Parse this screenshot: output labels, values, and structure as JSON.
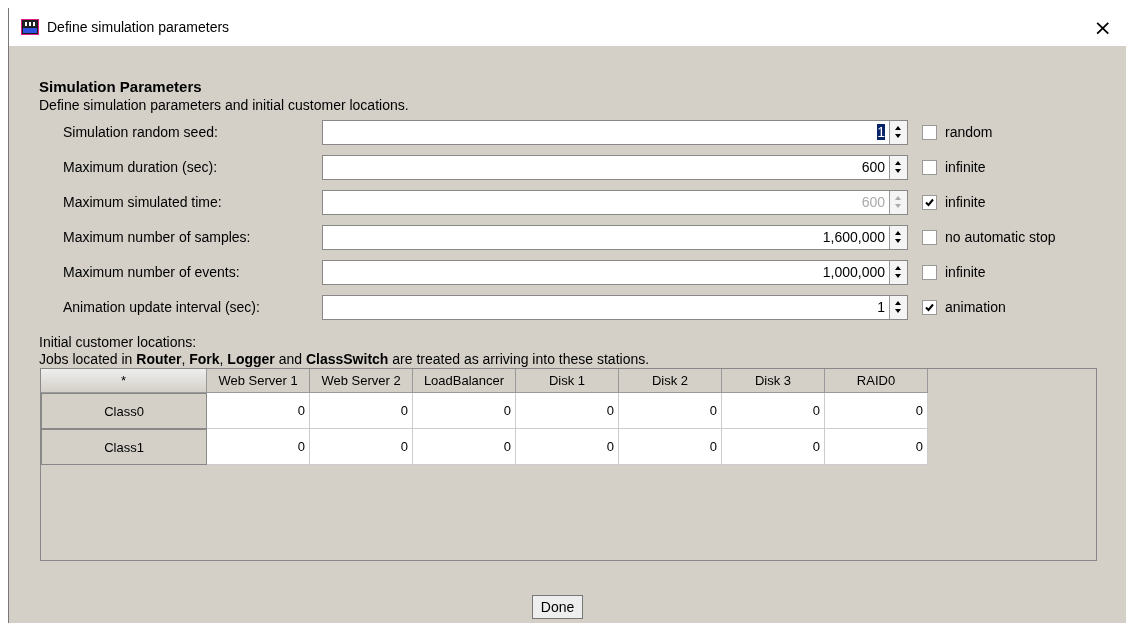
{
  "window": {
    "title": "Define simulation parameters",
    "close": "×"
  },
  "heading": "Simulation Parameters",
  "subtitle": "Define simulation parameters and initial customer locations.",
  "parameters": [
    {
      "label": "Simulation random seed:",
      "value": "1",
      "value_selected": true,
      "disabled": false,
      "option": {
        "label": "random",
        "checked": false
      }
    },
    {
      "label": "Maximum duration (sec):",
      "value": "600",
      "value_selected": false,
      "disabled": false,
      "option": {
        "label": "infinite",
        "checked": false
      }
    },
    {
      "label": "Maximum simulated time:",
      "value": "600",
      "value_selected": false,
      "disabled": true,
      "option": {
        "label": "infinite",
        "checked": true
      }
    },
    {
      "label": "Maximum number of samples:",
      "value": "1,600,000",
      "value_selected": false,
      "disabled": false,
      "option": {
        "label": "no automatic stop",
        "checked": false
      }
    },
    {
      "label": "Maximum number of events:",
      "value": "1,000,000",
      "value_selected": false,
      "disabled": false,
      "option": {
        "label": "infinite",
        "checked": false
      }
    },
    {
      "label": "Animation update interval (sec):",
      "value": "1",
      "value_selected": false,
      "disabled": false,
      "option": {
        "label": "animation",
        "checked": true
      }
    }
  ],
  "locations": {
    "title": "Initial customer locations:",
    "note": "Jobs located in **Router**, **Fork**, **Logger** and **ClassSwitch** are treated as arriving into these stations.",
    "table": {
      "columns": [
        "*",
        "Web Server 1",
        "Web Server 2",
        "LoadBalancer",
        "Disk 1",
        "Disk 2",
        "Disk 3",
        "RAID0"
      ],
      "rows": [
        {
          "name": "Class0",
          "values": [
            "0",
            "0",
            "0",
            "0",
            "0",
            "0",
            "0"
          ]
        },
        {
          "name": "Class1",
          "values": [
            "0",
            "0",
            "0",
            "0",
            "0",
            "0",
            "0"
          ]
        }
      ]
    }
  },
  "buttons": [
    "Done"
  ]
}
